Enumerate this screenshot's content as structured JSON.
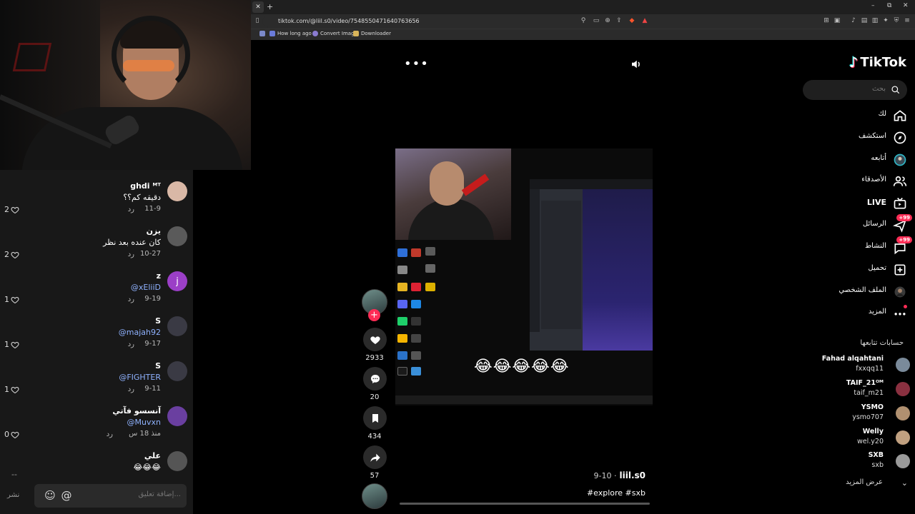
{
  "comments": {
    "items": [
      {
        "name": "ghdi ᴹᵀ",
        "text": "دقيقه كم؟؟",
        "date": "11-9",
        "reply": "رد",
        "likes": "2",
        "avatar_color": "#d9b8a6",
        "avatar_letter": ""
      },
      {
        "name": "يزن",
        "text": "كان عنده بعد نظر",
        "date": "10-27",
        "reply": "رد",
        "likes": "2",
        "avatar_color": "#5a5a5a",
        "avatar_letter": ""
      },
      {
        "name": "z",
        "text": "@xEliiD",
        "date": "9-19",
        "reply": "رد",
        "likes": "1",
        "avatar_color": "#9b3fc7",
        "avatar_letter": "j",
        "mention": true
      },
      {
        "name": "S",
        "text": "@majah92",
        "date": "9-17",
        "reply": "رد",
        "likes": "1",
        "avatar_color": "#3a3a44",
        "avatar_letter": "",
        "mention": true
      },
      {
        "name": "S",
        "text": "@FIGHTER",
        "date": "9-11",
        "reply": "رد",
        "likes": "1",
        "avatar_color": "#3a3a44",
        "avatar_letter": "",
        "mention": true
      },
      {
        "name": "آنسسو فآتي",
        "text": "@Muvxn",
        "date": "منذ 18 س",
        "reply": "رد",
        "likes": "0",
        "avatar_color": "#6a3fa0",
        "avatar_letter": "",
        "mention": true
      },
      {
        "name": "علي",
        "text": "😂😂😂",
        "date": "",
        "reply": "",
        "likes": "",
        "avatar_color": "#555555",
        "avatar_letter": ""
      }
    ],
    "dash": "--",
    "input_placeholder": "إضافة تعليق...",
    "post_label": "نشر",
    "mention_icon": "@",
    "emoji_icon": "☺"
  },
  "browser": {
    "tab_close": "✕",
    "new_tab": "+",
    "url": "tiktok.com/@liil.s0/video/7548550471640763656",
    "bookmarks": [
      "How long ago",
      "Convert Image",
      "Downloader"
    ],
    "window_controls": [
      "–",
      "⧉",
      "✕"
    ]
  },
  "video": {
    "more": "•••",
    "emoji_row": "😂😂😂😂😂",
    "author": "liil.s0",
    "date": "9-10 ·",
    "caption": "#explore #sxb",
    "likes": "2933",
    "comments": "20",
    "saves": "434",
    "shares": "57",
    "follow_plus": "+"
  },
  "sidebar": {
    "logo": "TikTok",
    "logo_icon": "♪",
    "search_placeholder": "بحث",
    "nav": [
      {
        "label": "لك",
        "icon": "home-icon"
      },
      {
        "label": "استكشف",
        "icon": "compass-icon"
      },
      {
        "label": "أتابعه",
        "icon": "avatar-icon"
      },
      {
        "label": "الأصدقاء",
        "icon": "friends-icon"
      },
      {
        "label": "LIVE",
        "icon": "live-icon"
      },
      {
        "label": "الرسائل",
        "icon": "messages-icon",
        "badge": "+99"
      },
      {
        "label": "النشاط",
        "icon": "activity-icon",
        "badge": "+99"
      },
      {
        "label": "تحميل",
        "icon": "upload-icon"
      },
      {
        "label": "الملف الشخصي",
        "icon": "profile-icon"
      },
      {
        "label": "المزيد",
        "icon": "more-icon"
      }
    ],
    "following_title": "حسابات تتابعها",
    "following": [
      {
        "name": "Fahad alqahtani",
        "handle": "fxxqq11",
        "color": "#7a8a9a"
      },
      {
        "name": "TAIF_21ᴼᴹ",
        "handle": "taif_m21",
        "color": "#8a3040"
      },
      {
        "name": "YSMO",
        "handle": "ysmo707",
        "color": "#b09070"
      },
      {
        "name": "Welly",
        "handle": "wel.y20",
        "color": "#c0a080"
      },
      {
        "name": "SXB",
        "handle": "sxb",
        "color": "#9a9a9a"
      }
    ],
    "see_more": "عرض المزيد"
  },
  "colors": {
    "accent": "#fe2c55",
    "mention": "#8fb2ff",
    "panel": "#181818"
  }
}
